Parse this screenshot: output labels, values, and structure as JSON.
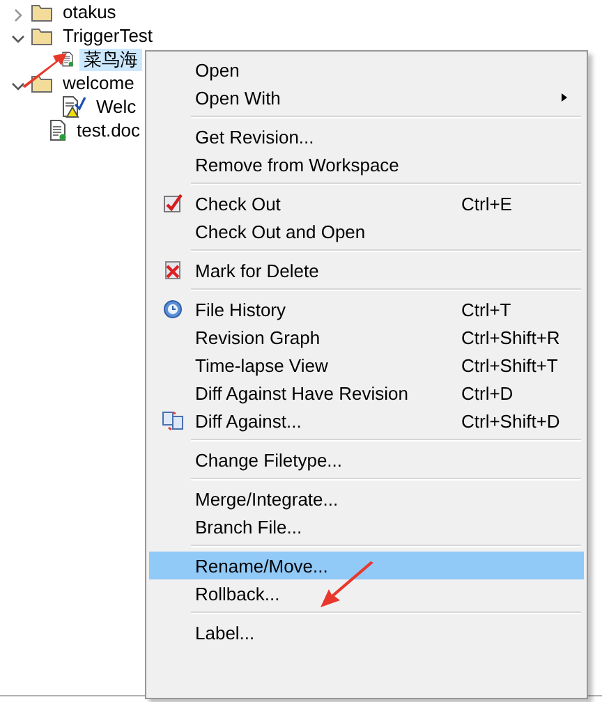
{
  "tree": [
    {
      "label": "otakus",
      "kind": "folder",
      "expanded": false,
      "selected": false
    },
    {
      "label": "TriggerTest",
      "kind": "folder",
      "expanded": true,
      "selected": false,
      "children": [
        {
          "label": "菜鸟海",
          "kind": "file",
          "selected": true
        }
      ]
    },
    {
      "label": "welcome",
      "kind": "folder",
      "expanded": true,
      "selected": false,
      "children": [
        {
          "label": "Welc",
          "kind": "edited-file",
          "selected": false
        }
      ]
    },
    {
      "label": "test.doc",
      "kind": "file",
      "selected": false
    }
  ],
  "context_menu": [
    {
      "kind": "item",
      "label": "Open",
      "selected": false
    },
    {
      "kind": "submenu",
      "label": "Open With",
      "selected": false
    },
    {
      "kind": "separator"
    },
    {
      "kind": "item",
      "label": "Get Revision...",
      "selected": false
    },
    {
      "kind": "item",
      "label": "Remove from Workspace",
      "selected": false
    },
    {
      "kind": "separator"
    },
    {
      "kind": "item",
      "label": "Check Out",
      "shortcut": "Ctrl+E",
      "selected": false
    },
    {
      "kind": "item",
      "label": "Check Out and Open",
      "selected": false
    },
    {
      "kind": "separator"
    },
    {
      "kind": "item",
      "label": "Mark for Delete",
      "selected": false
    },
    {
      "kind": "separator"
    },
    {
      "kind": "item",
      "label": "File History",
      "shortcut": "Ctrl+T",
      "selected": false
    },
    {
      "kind": "item",
      "label": "Revision Graph",
      "shortcut": "Ctrl+Shift+R",
      "selected": false
    },
    {
      "kind": "item",
      "label": "Time-lapse View",
      "shortcut": "Ctrl+Shift+T",
      "selected": false
    },
    {
      "kind": "item",
      "label": "Diff Against Have Revision",
      "shortcut": "Ctrl+D",
      "selected": false
    },
    {
      "kind": "item",
      "label": "Diff Against...",
      "shortcut": "Ctrl+Shift+D",
      "selected": false
    },
    {
      "kind": "separator"
    },
    {
      "kind": "item",
      "label": "Change Filetype...",
      "selected": false
    },
    {
      "kind": "separator"
    },
    {
      "kind": "item",
      "label": "Merge/Integrate...",
      "selected": false
    },
    {
      "kind": "item",
      "label": "Branch File...",
      "selected": false
    },
    {
      "kind": "separator"
    },
    {
      "kind": "item",
      "label": "Rename/Move...",
      "selected": true
    },
    {
      "kind": "item",
      "label": "Rollback...",
      "selected": false
    },
    {
      "kind": "separator"
    },
    {
      "kind": "item",
      "label": "Label...",
      "selected": false
    }
  ],
  "annotations": [
    {
      "kind": "arrow"
    },
    {
      "kind": "arrow"
    }
  ]
}
